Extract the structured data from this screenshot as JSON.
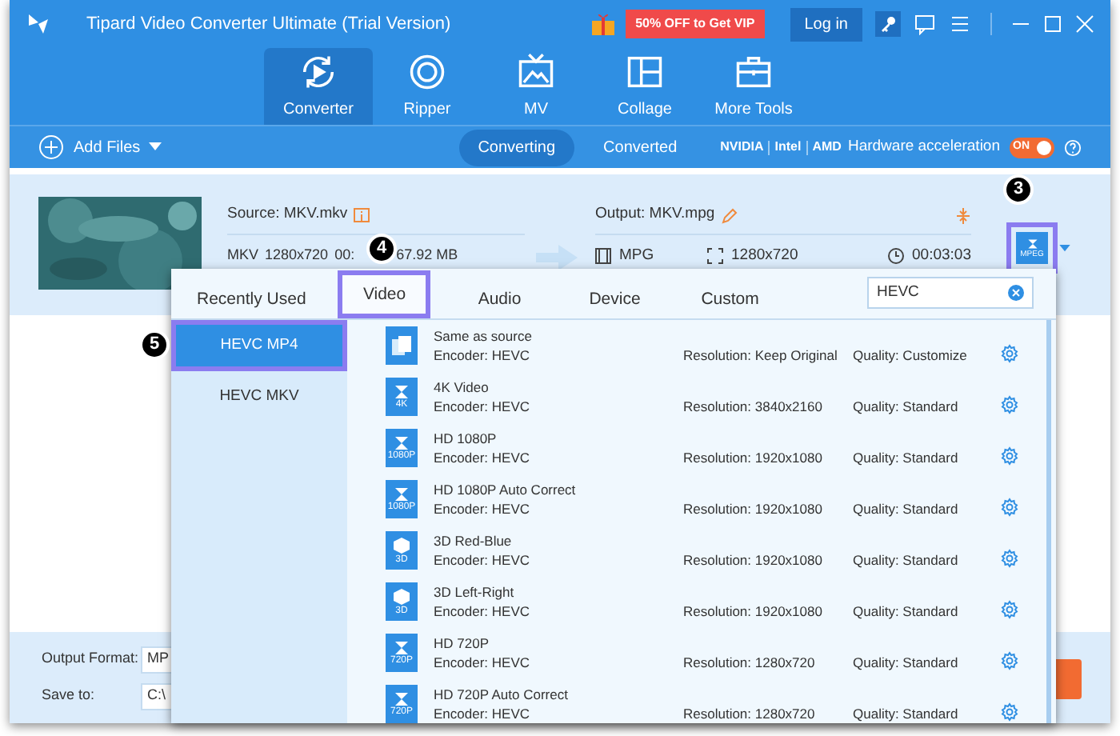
{
  "window": {
    "title": "Tipard Video Converter Ultimate (Trial Version)"
  },
  "promo": "50% OFF to Get VIP",
  "login": "Log in",
  "nav": [
    {
      "label": "Converter",
      "selected": true
    },
    {
      "label": "Ripper",
      "selected": false
    },
    {
      "label": "MV",
      "selected": false
    },
    {
      "label": "Collage",
      "selected": false
    },
    {
      "label": "More Tools",
      "selected": false
    }
  ],
  "toolbar": {
    "add_files": "Add Files",
    "views": [
      {
        "label": "Converting",
        "selected": true
      },
      {
        "label": "Converted",
        "selected": false
      }
    ],
    "vendors": [
      "NVIDIA",
      "Intel",
      "AMD"
    ],
    "hw_label": "Hardware acceleration",
    "hw_toggle": {
      "label": "ON",
      "on": true
    }
  },
  "file": {
    "source": "Source: MKV.mkv",
    "source_meta": [
      "MKV",
      "1280x720",
      "00:",
      "67.92 MB"
    ],
    "output": "Output: MKV.mpg",
    "out_format": "MPG",
    "out_resolution": "1280x720",
    "out_duration": "00:03:03",
    "format_badge": "MPEG"
  },
  "popup": {
    "tabs": [
      {
        "label": "Recently Used",
        "selected": false
      },
      {
        "label": "Video",
        "selected": true
      },
      {
        "label": "Audio",
        "selected": false
      },
      {
        "label": "Device",
        "selected": false
      },
      {
        "label": "Custom",
        "selected": false
      }
    ],
    "search": "HEVC",
    "categories": [
      {
        "label": "HEVC MP4",
        "selected": true
      },
      {
        "label": "HEVC MKV",
        "selected": false
      }
    ],
    "presets": [
      {
        "name": "Same as source",
        "kind": "copy",
        "encoder": "Encoder: HEVC",
        "resolution": "Resolution: Keep Original",
        "quality": "Quality: Customize"
      },
      {
        "name": "4K Video",
        "kind": "film",
        "badge": "4K",
        "encoder": "Encoder: HEVC",
        "resolution": "Resolution: 3840x2160",
        "quality": "Quality: Standard"
      },
      {
        "name": "HD 1080P",
        "kind": "film",
        "badge": "1080P",
        "encoder": "Encoder: HEVC",
        "resolution": "Resolution: 1920x1080",
        "quality": "Quality: Standard"
      },
      {
        "name": "HD 1080P Auto Correct",
        "kind": "film",
        "badge": "1080P",
        "encoder": "Encoder: HEVC",
        "resolution": "Resolution: 1920x1080",
        "quality": "Quality: Standard"
      },
      {
        "name": "3D Red-Blue",
        "kind": "cube",
        "badge": "3D",
        "encoder": "Encoder: HEVC",
        "resolution": "Resolution: 1920x1080",
        "quality": "Quality: Standard"
      },
      {
        "name": "3D Left-Right",
        "kind": "cube",
        "badge": "3D",
        "encoder": "Encoder: HEVC",
        "resolution": "Resolution: 1920x1080",
        "quality": "Quality: Standard"
      },
      {
        "name": "HD 720P",
        "kind": "film",
        "badge": "720P",
        "encoder": "Encoder: HEVC",
        "resolution": "Resolution: 1280x720",
        "quality": "Quality: Standard"
      },
      {
        "name": "HD 720P Auto Correct",
        "kind": "film",
        "badge": "720P",
        "encoder": "Encoder: HEVC",
        "resolution": "Resolution: 1280x720",
        "quality": "Quality: Standard"
      }
    ]
  },
  "bottom": {
    "output_format_label": "Output Format:",
    "output_format": "MP",
    "save_to_label": "Save to:",
    "save_to": "C:\\"
  },
  "callouts": [
    "3",
    "4",
    "5"
  ]
}
